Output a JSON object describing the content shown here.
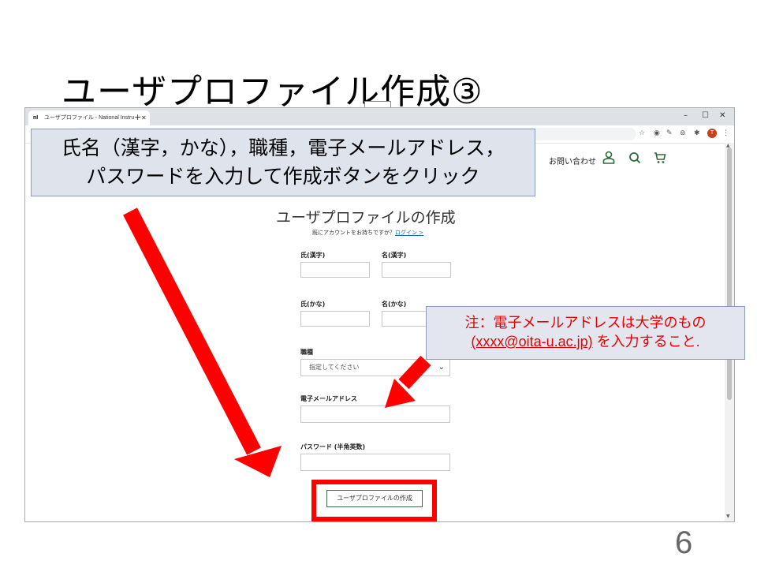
{
  "slide": {
    "title": "ユーザプロファイル作成③",
    "page_number": "6"
  },
  "browser": {
    "tab_logo": "nI",
    "tab_title": "ユーザプロファイル - National Instru",
    "tab_close": "✕",
    "new_tab": "+",
    "window_controls": {
      "minimize": "–",
      "maximize": "☐",
      "close": "✕"
    },
    "profile_initial": "T"
  },
  "site_nav": {
    "contact": "お問い合わせ",
    "icons": [
      "account-icon",
      "search-icon",
      "cart-icon"
    ]
  },
  "form": {
    "heading": "ユーザプロファイルの作成",
    "signin_prompt": "既にアカウントをお持ちですか？",
    "signin_link": "ログイン >",
    "last_name_kanji_label": "氏(漢字)",
    "first_name_kanji_label": "名(漢字)",
    "last_name_kana_label": "氏(かな)",
    "first_name_kana_label": "名(かな)",
    "job_label": "職種",
    "job_select_value": "指定してください",
    "email_label": "電子メールアドレス",
    "password_label": "パスワード (半角英数)",
    "submit_label": "ユーザプロファイルの作成"
  },
  "callouts": {
    "main_line1": "氏名（漢字，かな），職種，電子メールアドレス，",
    "main_line2": "パスワードを入力して作成ボタンをクリック",
    "note_line1": "注：電子メールアドレスは大学のもの",
    "note_email": "(xxxx@oita-u.ac.jp)",
    "note_line2_rest": " を入力すること."
  },
  "colors": {
    "arrow": "#ff0000",
    "note_text": "#e60000",
    "brand_green": "#2f6b3a"
  }
}
